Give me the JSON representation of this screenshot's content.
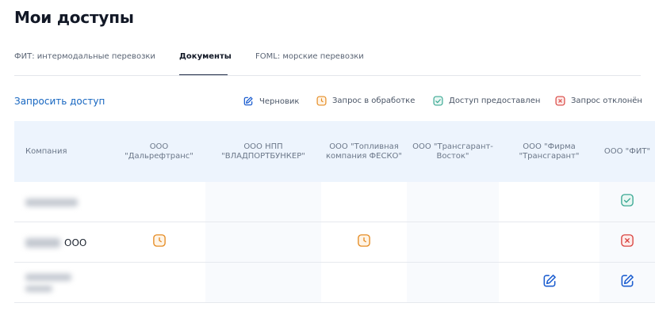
{
  "page_title": "Мои доступы",
  "tabs": [
    {
      "label": "ФИТ: интермодальные перевозки",
      "active": false
    },
    {
      "label": "Документы",
      "active": true
    },
    {
      "label": "FOML: морские перевозки",
      "active": false
    }
  ],
  "request_access_label": "Запросить доступ",
  "legend": {
    "draft": {
      "label": "Черновик",
      "icon": "pencil-square-icon",
      "color": "#1e5fd0"
    },
    "pending": {
      "label": "Запрос в обработке",
      "icon": "clock-icon",
      "color": "#e58b22"
    },
    "granted": {
      "label": "Доступ предоставлен",
      "icon": "check-icon",
      "color": "#3aa893"
    },
    "rejected": {
      "label": "Запрос отклонён",
      "icon": "cross-icon",
      "color": "#d9433f"
    }
  },
  "table": {
    "first_header": "Компания",
    "columns": [
      "ООО \"Дальрефтранс\"",
      "ООО НПП \"ВЛАДПОРТБУНКЕР\"",
      "ООО \"Топливная компания ФЕСКО\"",
      "ООО \"Трансгарант-Восток\"",
      "ООО \"Фирма \"Трансгарант\"",
      "ООО \"ФИТ\""
    ],
    "rows": [
      {
        "company_visible_text": "",
        "cells": [
          "",
          "",
          "",
          "",
          "",
          "granted"
        ]
      },
      {
        "company_visible_text": "ООО",
        "cells": [
          "pending",
          "",
          "pending",
          "",
          "",
          "rejected"
        ]
      },
      {
        "company_visible_text": "",
        "cells": [
          "",
          "",
          "",
          "",
          "draft",
          "draft"
        ]
      }
    ]
  }
}
